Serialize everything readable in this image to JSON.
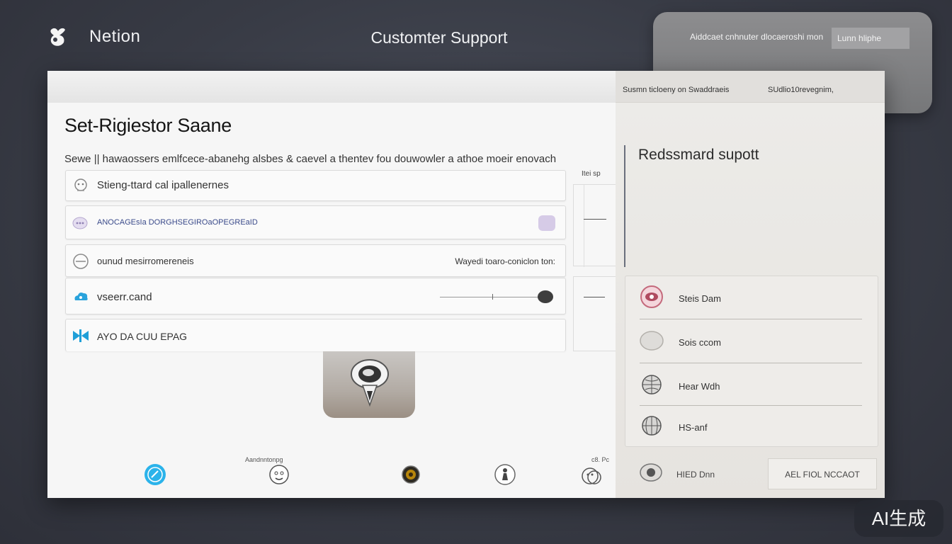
{
  "header": {
    "brand": "Netion",
    "title": "Customter Support",
    "card_left": "Aiddcaet cnhnuter dlocaeroshi mon",
    "card_right": "Lunn hliphe"
  },
  "window": {
    "topbar_right_a": "Susmn ticloeny on Swaddraeis",
    "topbar_right_b": "SUdlio10revegnim,",
    "page_title": "Set-Rigiestor Saane",
    "description": "Sewe || hawaossers emlfcece-abanehg alsbes & caevel a thentev fou douwowler a athoe moeir enovach",
    "rows": [
      {
        "label": "Stieng-ttard cal ipallenernes"
      },
      {
        "label": "ANOCAGEsIa DORGHSEGIROaOPEGREaID"
      },
      {
        "label": "ounud mesirromereneis",
        "right": "Wayedi toaro-coniclon ton:"
      },
      {
        "label": "vseerr.cand"
      },
      {
        "label": "AYO DA CUU EPAG"
      }
    ],
    "mid_label": "Itei sp",
    "bottom_caption_1": "Aandnntonpg",
    "bottom_caption_2": "c8. Pc"
  },
  "right_panel": {
    "title": "Redssmard supott",
    "items": [
      {
        "label": "Steis Dam"
      },
      {
        "label": "Sois ccom"
      },
      {
        "label": "Hear Wdh"
      },
      {
        "label": "HS-anf"
      }
    ],
    "footer_label": "HIED Dnn",
    "footer_button": "AEL FIOL NCCAOT"
  },
  "watermark": "AI生成"
}
